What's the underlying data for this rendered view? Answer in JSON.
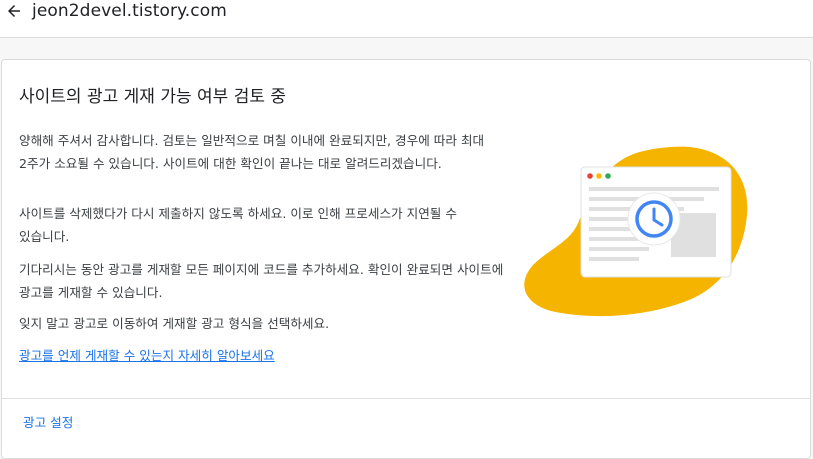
{
  "topbar": {
    "back_icon": "arrow-back-icon",
    "site": "jeon2devel.tistory.com"
  },
  "card": {
    "title": "사이트의 광고 게재 가능 여부 검토 중",
    "paragraphs": [
      "양해해 주셔서 감사합니다. 검토는 일반적으로 며칠 이내에 완료되지만, 경우에 따라 최대 2주가 소요될 수 있습니다. 사이트에 대한 확인이 끝나는 대로 알려드리겠습니다.",
      "사이트를 삭제했다가 다시 제출하지 않도록 하세요. 이로 인해 프로세스가 지연될 수 있습니다.",
      "기다리시는 동안 광고를 게재할 모든 페이지에 코드를 추가하세요. 확인이 완료되면 사이트에 광고를 게재할 수 있습니다.",
      "잊지 말고 광고로 이동하여 게재할 광고 형식을 선택하세요."
    ],
    "learn_more": "광고를 언제 게재할 수 있는지 자세히 알아보세요",
    "footer_link": "광고 설정"
  },
  "illustration": {
    "icon": "clock-icon",
    "blob_color": "#f5b400",
    "clock_color": "#4285f4",
    "dot_colors": [
      "#ea4335",
      "#fbbc04",
      "#34a853"
    ]
  }
}
